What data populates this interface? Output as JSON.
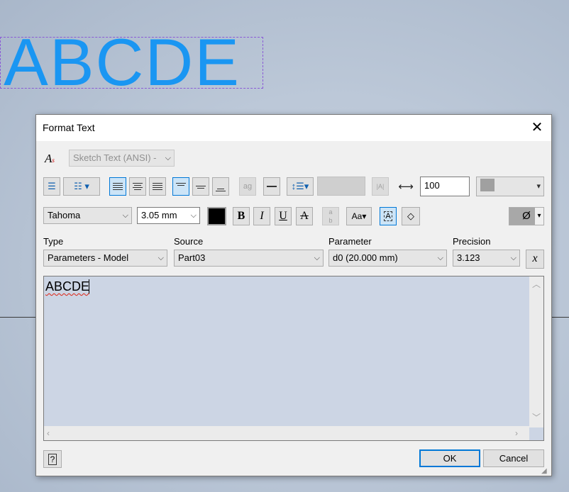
{
  "canvas": {
    "sketch_text": "ABCDE"
  },
  "dialog": {
    "title": "Format Text",
    "style_combo": "Sketch Text (ANSI) -",
    "spacing_value": "100",
    "font": "Tahoma",
    "font_size": "3.05 mm",
    "bold_label": "B",
    "italic_label": "I",
    "underline_label": "U",
    "strike_label": "A",
    "symbol_label": "Ø",
    "type_label": "Type",
    "type_value": "Parameters - Model",
    "source_label": "Source",
    "source_value": "Part03",
    "parameter_label": "Parameter",
    "parameter_value": "d0 (20.000 mm)",
    "precision_label": "Precision",
    "precision_value": "3.123",
    "editor_text": "ABCDE",
    "ok_label": "OK",
    "cancel_label": "Cancel",
    "text_color": "#000000",
    "accent_color": "#0078d7"
  }
}
